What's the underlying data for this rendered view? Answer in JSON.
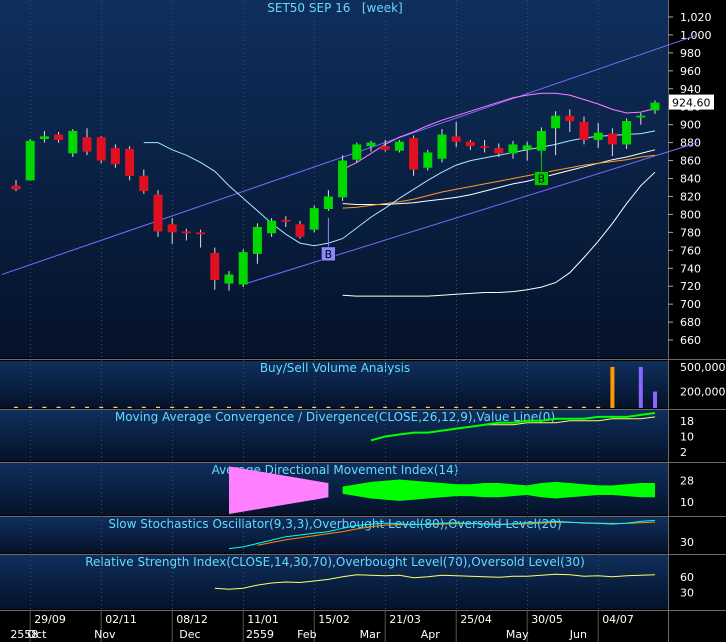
{
  "colors": {
    "background_top": "#0f2f5c",
    "background_bottom": "#05122a",
    "up_candle": "#00d800",
    "down_candle": "#e01020",
    "ma10": "#a8e8ff",
    "ma50": "#ff9922",
    "ma200": "#ffffff",
    "bollinger": "#ff80ff",
    "trendline": "#7a6cff",
    "title_text": "#66d9ff",
    "axis_text": "#ffffff",
    "price_tag_bg": "#ffffff",
    "adx_plus": "#00ff00",
    "adx_minus": "#ff80ff",
    "stoch_k": "#00ffff",
    "stoch_d": "#ff8800",
    "rsi_line": "#ffff66",
    "macd_line": "#00ff00"
  },
  "chart_data": [
    {
      "panel": "price",
      "type": "candlestick",
      "title": "SET50 SEP 16   [week]",
      "ylim": [
        640,
        1030
      ],
      "y_ticks": [
        660,
        680,
        700,
        720,
        740,
        760,
        780,
        800,
        820,
        840,
        860,
        880,
        900,
        920,
        940,
        960,
        980,
        "1,000",
        "1,020"
      ],
      "last_price_label": "924.60",
      "candles": [
        {
          "o": 832,
          "h": 838,
          "l": 826,
          "c": 828
        },
        {
          "o": 838,
          "h": 884,
          "l": 838,
          "c": 882
        },
        {
          "o": 884,
          "h": 893,
          "l": 880,
          "c": 887
        },
        {
          "o": 889,
          "h": 892,
          "l": 880,
          "c": 883
        },
        {
          "o": 868,
          "h": 895,
          "l": 864,
          "c": 893
        },
        {
          "o": 886,
          "h": 896,
          "l": 866,
          "c": 870
        },
        {
          "o": 886,
          "h": 887,
          "l": 857,
          "c": 860
        },
        {
          "o": 874,
          "h": 878,
          "l": 852,
          "c": 856
        },
        {
          "o": 873,
          "h": 876,
          "l": 838,
          "c": 843
        },
        {
          "o": 843,
          "h": 850,
          "l": 823,
          "c": 826
        },
        {
          "o": 822,
          "h": 827,
          "l": 775,
          "c": 781
        },
        {
          "o": 789,
          "h": 796,
          "l": 767,
          "c": 780
        },
        {
          "o": 781,
          "h": 784,
          "l": 771,
          "c": 779
        },
        {
          "o": 780,
          "h": 783,
          "l": 763,
          "c": 778
        },
        {
          "o": 757,
          "h": 763,
          "l": 716,
          "c": 727
        },
        {
          "o": 723,
          "h": 737,
          "l": 715,
          "c": 733
        },
        {
          "o": 722,
          "h": 761,
          "l": 719,
          "c": 758
        },
        {
          "o": 756,
          "h": 790,
          "l": 745,
          "c": 786
        },
        {
          "o": 779,
          "h": 796,
          "l": 775,
          "c": 793
        },
        {
          "o": 794,
          "h": 798,
          "l": 786,
          "c": 792
        },
        {
          "o": 789,
          "h": 793,
          "l": 773,
          "c": 775
        },
        {
          "o": 783,
          "h": 810,
          "l": 780,
          "c": 807
        },
        {
          "o": 806,
          "h": 827,
          "l": 804,
          "c": 820
        },
        {
          "o": 819,
          "h": 866,
          "l": 815,
          "c": 860
        },
        {
          "o": 861,
          "h": 880,
          "l": 858,
          "c": 878
        },
        {
          "o": 876,
          "h": 882,
          "l": 870,
          "c": 880
        },
        {
          "o": 876,
          "h": 883,
          "l": 870,
          "c": 872
        },
        {
          "o": 871,
          "h": 883,
          "l": 869,
          "c": 881
        },
        {
          "o": 885,
          "h": 888,
          "l": 843,
          "c": 850
        },
        {
          "o": 852,
          "h": 872,
          "l": 849,
          "c": 869
        },
        {
          "o": 862,
          "h": 895,
          "l": 858,
          "c": 889
        },
        {
          "o": 887,
          "h": 903,
          "l": 875,
          "c": 881
        },
        {
          "o": 881,
          "h": 883,
          "l": 872,
          "c": 876
        },
        {
          "o": 876,
          "h": 883,
          "l": 869,
          "c": 875
        },
        {
          "o": 874,
          "h": 879,
          "l": 864,
          "c": 868
        },
        {
          "o": 868,
          "h": 882,
          "l": 862,
          "c": 878
        },
        {
          "o": 872,
          "h": 881,
          "l": 860,
          "c": 877
        },
        {
          "o": 871,
          "h": 897,
          "l": 864,
          "c": 893
        },
        {
          "o": 896,
          "h": 915,
          "l": 866,
          "c": 910
        },
        {
          "o": 910,
          "h": 917,
          "l": 892,
          "c": 904
        },
        {
          "o": 903,
          "h": 909,
          "l": 878,
          "c": 883
        },
        {
          "o": 883,
          "h": 902,
          "l": 874,
          "c": 891
        },
        {
          "o": 890,
          "h": 896,
          "l": 865,
          "c": 878
        },
        {
          "o": 878,
          "h": 907,
          "l": 873,
          "c": 904
        },
        {
          "o": 908,
          "h": 913,
          "l": 900,
          "c": 910
        },
        {
          "o": 916,
          "h": 927,
          "l": 912,
          "c": 924.6
        }
      ],
      "ma10": [
        null,
        null,
        null,
        null,
        null,
        null,
        null,
        null,
        null,
        880,
        880,
        872,
        866,
        858,
        848,
        832,
        818,
        804,
        790,
        778,
        768,
        765,
        768,
        773,
        785,
        797,
        807,
        818,
        828,
        838,
        847,
        855,
        860,
        863,
        866,
        869,
        872,
        875,
        878,
        882,
        885,
        887,
        888,
        889,
        890,
        893
      ],
      "ma50": [
        null,
        null,
        null,
        null,
        null,
        null,
        null,
        null,
        null,
        null,
        null,
        null,
        null,
        null,
        null,
        null,
        null,
        null,
        null,
        null,
        null,
        null,
        null,
        807,
        808,
        810,
        812,
        814,
        817,
        821,
        825,
        828,
        831,
        834,
        837,
        840,
        843,
        846,
        849,
        852,
        855,
        857,
        859,
        861,
        864,
        866
      ],
      "ma200": [
        null,
        null,
        null,
        null,
        null,
        null,
        null,
        null,
        null,
        null,
        null,
        null,
        null,
        null,
        null,
        null,
        null,
        null,
        null,
        null,
        null,
        null,
        null,
        812,
        811,
        811,
        811,
        812,
        813,
        815,
        817,
        819,
        822,
        826,
        830,
        834,
        837,
        841,
        845,
        849,
        853,
        857,
        861,
        864,
        868,
        872
      ],
      "bb_upper": [
        null,
        null,
        null,
        null,
        null,
        null,
        null,
        null,
        null,
        null,
        null,
        null,
        null,
        null,
        null,
        null,
        null,
        null,
        null,
        null,
        null,
        null,
        null,
        850,
        858,
        868,
        878,
        886,
        892,
        899,
        905,
        910,
        915,
        920,
        925,
        930,
        933,
        935,
        935,
        933,
        928,
        923,
        917,
        913,
        914,
        918
      ],
      "bb_lower": [
        null,
        null,
        null,
        null,
        null,
        null,
        null,
        null,
        null,
        null,
        null,
        null,
        null,
        null,
        null,
        null,
        null,
        null,
        null,
        null,
        null,
        null,
        null,
        710,
        709,
        709,
        709,
        709,
        709,
        709,
        710,
        711,
        712,
        713,
        713,
        714,
        716,
        719,
        724,
        735,
        752,
        770,
        790,
        812,
        832,
        847
      ],
      "trendlines": [
        {
          "from": [
            -1,
            733
          ],
          "to": [
            48,
            1000
          ]
        },
        {
          "from": [
            16,
            722
          ],
          "to": [
            48,
            880
          ]
        }
      ],
      "signals": [
        {
          "label": "B",
          "index": 22,
          "value": 756,
          "color": "#8a8aff"
        },
        {
          "label": "B",
          "index": 37,
          "value": 840,
          "color": "#00cc00"
        }
      ],
      "x_dates": [
        "29/09",
        "02/11",
        "08/12",
        "11/01",
        "15/02",
        "21/03",
        "25/04",
        "30/05",
        "04/07"
      ],
      "x_months": [
        "2558",
        "Oct",
        "Nov",
        "Dec",
        "2559",
        "Feb",
        "Mar",
        "Apr",
        "May",
        "Jun"
      ]
    },
    {
      "panel": "volume",
      "type": "bar",
      "title": "Buy/Sell Volume Analysis",
      "y_ticks": [
        "500,000",
        "200,000"
      ],
      "ylim": [
        0,
        560000
      ],
      "values": [
        15000,
        15000,
        15000,
        15000,
        15000,
        15000,
        15000,
        15000,
        15000,
        15000,
        15000,
        15000,
        15000,
        15000,
        15000,
        15000,
        15000,
        15000,
        15000,
        15000,
        15000,
        15000,
        15000,
        15000,
        15000,
        15000,
        15000,
        15000,
        15000,
        15000,
        15000,
        15000,
        15000,
        15000,
        15000,
        15000,
        15000,
        15000,
        15000,
        15000,
        15000,
        15000,
        500000,
        0,
        500000,
        200000
      ],
      "highlight_colors": {
        "42": "#ff9900",
        "44": "#8866ff",
        "45": "#8866ff"
      }
    },
    {
      "panel": "macd",
      "type": "line",
      "title": "Moving Average Convergence / Divergence(CLOSE,26,12,9),Value Line(0)",
      "y_ticks": [
        18,
        10,
        2
      ],
      "ylim": [
        -2,
        23
      ],
      "macd": [
        null,
        null,
        null,
        null,
        null,
        null,
        null,
        null,
        null,
        null,
        null,
        null,
        null,
        null,
        null,
        null,
        null,
        null,
        null,
        null,
        null,
        null,
        null,
        null,
        null,
        8,
        10,
        11,
        12,
        12,
        13,
        14,
        15,
        16,
        17,
        17,
        18,
        18,
        19,
        19,
        19,
        20,
        20,
        20,
        21,
        22
      ],
      "signal": [
        null,
        null,
        null,
        null,
        null,
        null,
        null,
        null,
        null,
        null,
        null,
        null,
        null,
        null,
        null,
        null,
        null,
        null,
        null,
        null,
        null,
        null,
        null,
        null,
        null,
        null,
        null,
        null,
        null,
        null,
        null,
        null,
        null,
        16,
        16,
        16,
        17,
        17,
        17,
        18,
        18,
        18,
        19,
        19,
        19,
        20
      ]
    },
    {
      "panel": "adx",
      "type": "area",
      "title": "Average Directional Movement Index(14)",
      "y_ticks": [
        28,
        10
      ],
      "ylim": [
        0,
        42
      ],
      "minus_half_width": [
        null,
        null,
        null,
        null,
        null,
        null,
        null,
        null,
        null,
        null,
        null,
        null,
        null,
        null,
        null,
        20,
        18,
        16,
        14,
        12,
        10,
        8,
        6,
        null,
        null,
        null,
        null,
        null,
        null,
        null,
        null,
        null,
        null,
        null,
        null,
        null,
        null,
        null,
        null,
        null,
        null,
        null,
        null,
        null,
        null,
        null
      ],
      "plus_half_width": [
        null,
        null,
        null,
        null,
        null,
        null,
        null,
        null,
        null,
        null,
        null,
        null,
        null,
        null,
        null,
        null,
        null,
        null,
        null,
        null,
        null,
        null,
        null,
        3,
        5,
        7,
        8,
        9,
        8,
        7,
        6,
        5,
        5,
        6,
        6,
        5,
        4,
        6,
        7,
        6,
        5,
        4,
        4,
        5,
        6,
        6
      ],
      "center": 20
    },
    {
      "panel": "stochastic",
      "type": "line",
      "title": "Slow Stochastics Oscillator(9,3,3),Overbought Level(80),Oversold Level(20)",
      "y_ticks": [
        30
      ],
      "ylim": [
        0,
        100
      ],
      "k": [
        null,
        null,
        null,
        null,
        null,
        null,
        null,
        null,
        null,
        null,
        null,
        null,
        null,
        null,
        null,
        10,
        15,
        25,
        35,
        45,
        50,
        55,
        60,
        70,
        78,
        82,
        85,
        83,
        80,
        82,
        85,
        86,
        84,
        82,
        80,
        83,
        86,
        88,
        90,
        88,
        85,
        84,
        82,
        85,
        90,
        93
      ],
      "d": [
        null,
        null,
        null,
        null,
        null,
        null,
        null,
        null,
        null,
        null,
        null,
        null,
        null,
        null,
        null,
        null,
        null,
        20,
        28,
        36,
        42,
        48,
        54,
        60,
        68,
        74,
        79,
        80,
        81,
        81,
        82,
        83,
        84,
        83,
        82,
        82,
        83,
        85,
        87,
        87,
        86,
        85,
        84,
        84,
        86,
        88
      ]
    },
    {
      "panel": "rsi",
      "type": "line",
      "title": "Relative Strength Index(CLOSE,14,30,70),Overbought Level(70),Oversold Level(30)",
      "y_ticks": [
        60,
        30
      ],
      "ylim": [
        0,
        100
      ],
      "values": [
        null,
        null,
        null,
        null,
        null,
        null,
        null,
        null,
        null,
        null,
        null,
        null,
        null,
        null,
        38,
        36,
        38,
        44,
        48,
        50,
        49,
        52,
        55,
        60,
        64,
        63,
        62,
        63,
        58,
        60,
        63,
        62,
        61,
        60,
        59,
        61,
        61,
        63,
        65,
        64,
        61,
        62,
        60,
        62,
        63,
        64
      ]
    }
  ]
}
